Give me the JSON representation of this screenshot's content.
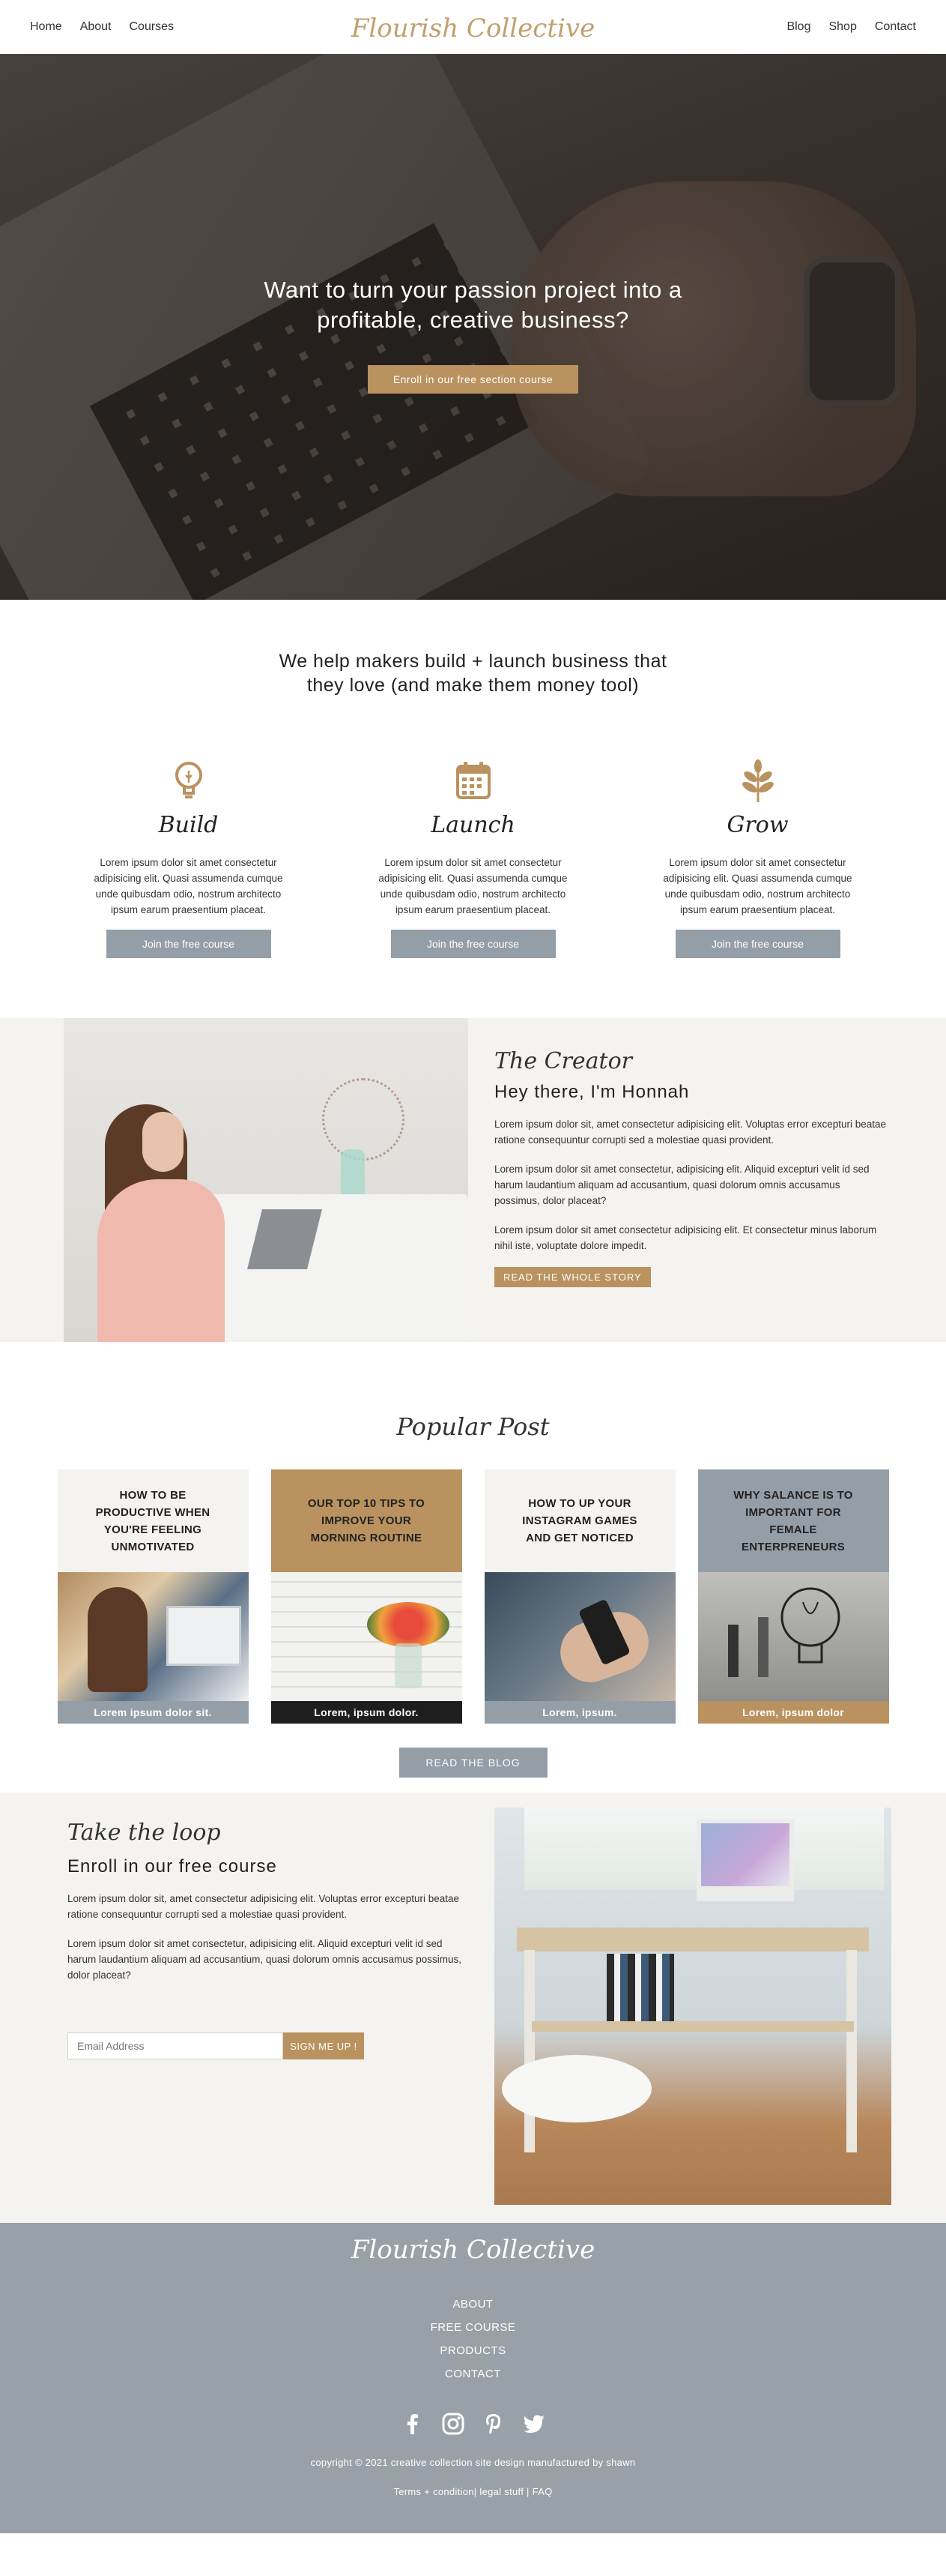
{
  "nav": {
    "left": [
      "Home",
      "About",
      "Courses"
    ],
    "logo": "Flourish Collective",
    "right": [
      "Blog",
      "Shop",
      "Contact"
    ]
  },
  "hero": {
    "title_line1": "Want to turn your passion project into a",
    "title_line2": "profitable, creative business?",
    "cta": "Enroll in our free section course"
  },
  "help": {
    "title_line1": "We help makers build + launch business that",
    "title_line2": "they love (and make them money tool)",
    "features": [
      {
        "icon": "lightbulb-icon",
        "title": "Build",
        "text": "Lorem ipsum dolor sit amet consectetur adipisicing elit. Quasi assumenda cumque unde quibusdam odio, nostrum architecto ipsum earum praesentium placeat.",
        "button": "Join the free course"
      },
      {
        "icon": "calendar-icon",
        "title": "Launch",
        "text": "Lorem ipsum dolor sit amet consectetur adipisicing elit. Quasi assumenda cumque unde quibusdam odio, nostrum architecto ipsum earum praesentium placeat.",
        "button": "Join the free course"
      },
      {
        "icon": "leaf-icon",
        "title": "Grow",
        "text": "Lorem ipsum dolor sit amet consectetur adipisicing elit. Quasi assumenda cumque unde quibusdam odio, nostrum architecto ipsum earum praesentium placeat.",
        "button": "Join the free course"
      }
    ]
  },
  "creator": {
    "subtitle": "The Creator",
    "heading": "Hey there, I'm Honnah",
    "paragraphs": [
      "Lorem ipsum dolor sit, amet consectetur adipisicing elit. Voluptas error excepturi beatae ratione consequuntur corrupti sed a molestiae quasi provident.",
      "Lorem ipsum dolor sit amet consectetur, adipisicing elit. Aliquid excepturi velit id sed harum laudantium aliquam ad accusantium, quasi dolorum omnis accusamus possimus, dolor placeat?",
      "Lorem ipsum dolor sit amet consectetur adipisicing elit. Et consectetur minus laborum nihil iste, voluptate dolore impedit."
    ],
    "button": "READ THE WHOLE STORY"
  },
  "popular": {
    "subtitle": "Popular Post",
    "posts": [
      {
        "title": "HOW TO BE PRODUCTIVE WHEN YOU'RE FEELING UNMOTIVATED",
        "caption": "Lorem ipsum dolor sit."
      },
      {
        "title": "OUR TOP 10 TIPS TO IMPROVE YOUR MORNING ROUTINE",
        "caption": "Lorem, ipsum dolor."
      },
      {
        "title": "HOW TO UP YOUR INSTAGRAM GAMES AND GET NOTICED",
        "caption": "Lorem, ipsum."
      },
      {
        "title": "WHY SALANCE IS TO IMPORTANT FOR FEMALE ENTERPRENEURS",
        "caption": "Lorem, ipsum dolor"
      }
    ],
    "button": "READ THE BLOG"
  },
  "loop": {
    "subtitle": "Take the loop",
    "heading": "Enroll in our free course",
    "paragraphs": [
      "Lorem ipsum dolor sit, amet consectetur adipisicing elit. Voluptas error excepturi beatae ratione consequuntur corrupti sed a molestiae quasi provident.",
      "Lorem ipsum dolor sit amet consectetur, adipisicing elit. Aliquid excepturi velit id sed harum laudantium aliquam ad accusantium, quasi dolorum omnis accusamus possimus, dolor placeat?"
    ],
    "email_placeholder": "Email Address",
    "button": "SIGN ME UP !"
  },
  "footer": {
    "logo": "Flourish Collective",
    "links": [
      "ABOUT",
      "FREE COURSE",
      "PRODUCTS",
      "CONTACT"
    ],
    "socials": [
      "facebook-icon",
      "instagram-icon",
      "pinterest-icon",
      "twitter-icon"
    ],
    "copyright": "copyright © 2021 creative collection site design manufactured by shawn",
    "legal": "Terms + condition| legal stuff | FAQ"
  },
  "colors": {
    "gold": "#b9925f",
    "gray": "#949ea6",
    "cream": "#f5f3ef",
    "footer": "#98a1a7"
  }
}
